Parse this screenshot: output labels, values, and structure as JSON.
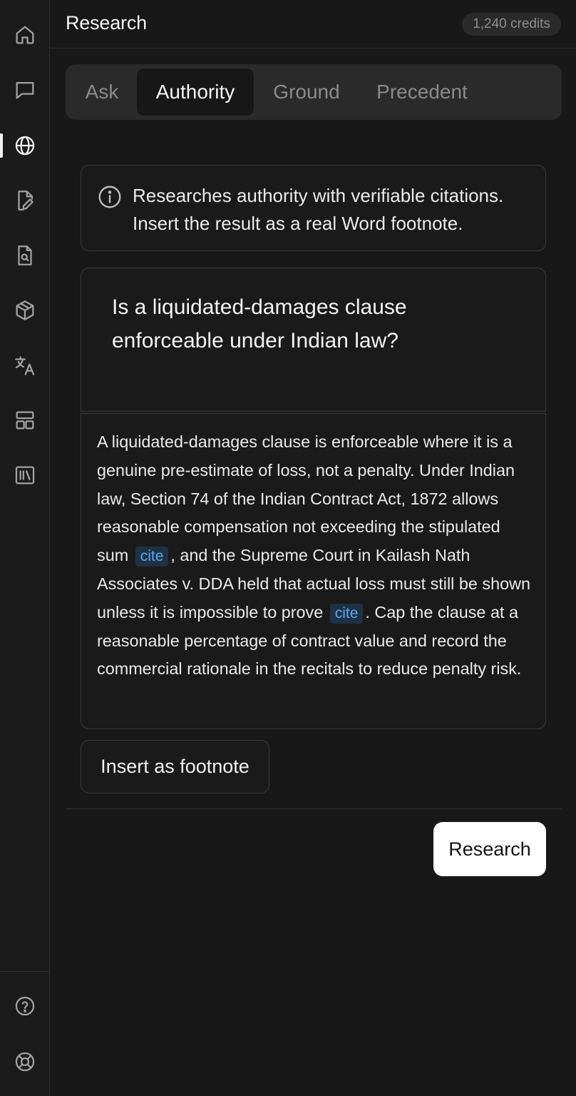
{
  "header": {
    "title": "Research",
    "credits": "1,240 credits"
  },
  "sidebar": {
    "items": [
      {
        "icon": "home-icon",
        "active": false
      },
      {
        "icon": "chat-icon",
        "active": false
      },
      {
        "icon": "globe-icon",
        "active": true
      },
      {
        "icon": "file-edit-icon",
        "active": false
      },
      {
        "icon": "file-search-icon",
        "active": false
      },
      {
        "icon": "cube-icon",
        "active": false
      },
      {
        "icon": "translate-icon",
        "active": false
      },
      {
        "icon": "layout-icon",
        "active": false
      },
      {
        "icon": "library-icon",
        "active": false
      }
    ],
    "footer": [
      {
        "icon": "help-icon"
      },
      {
        "icon": "lifebuoy-icon"
      }
    ]
  },
  "tabs": [
    {
      "label": "Ask",
      "active": false
    },
    {
      "label": "Authority",
      "active": true
    },
    {
      "label": "Ground",
      "active": false
    },
    {
      "label": "Precedent",
      "active": false
    }
  ],
  "info": {
    "text": "Researches authority with verifiable citations. Insert the result as a real Word footnote."
  },
  "question": {
    "text": "Is a liquidated-damages clause enforceable under Indian law?"
  },
  "answer": {
    "part1": "A liquidated-damages clause is enforceable where it is a genuine pre-estimate of loss, not a penalty. Under Indian law, Section 74 of the Indian Contract Act, 1872 allows reasonable compensation not exceeding the stipulated sum",
    "cite1": "cite",
    "part2": ", and the Supreme Court in Kailash Nath Associates v. DDA held that actual loss must still be shown unless it is impossible to prove",
    "cite2": "cite",
    "part3": ". Cap the clause at a reasonable percentage of contract value and record the commercial rationale in the recitals to reduce penalty risk."
  },
  "actions": {
    "insert_footnote": "Insert as footnote",
    "research": "Research"
  },
  "colors": {
    "background": "#181818",
    "cite_bg": "#1e3246",
    "cite_text": "#5ba8f0",
    "primary_button": "#ffffff"
  }
}
